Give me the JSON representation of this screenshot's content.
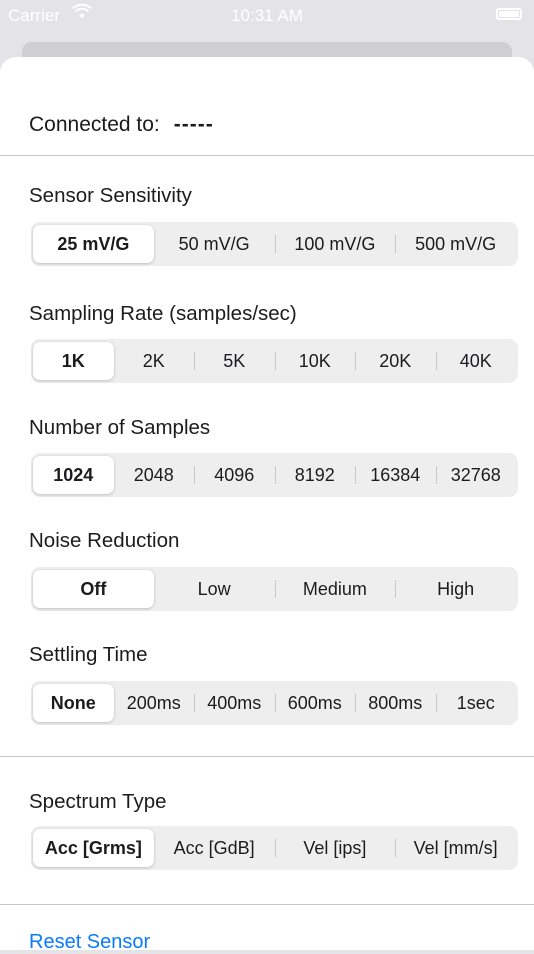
{
  "status_bar": {
    "carrier": "Carrier",
    "time": "10:31 AM"
  },
  "connection": {
    "label": "Connected to:",
    "value": "-----"
  },
  "settings": [
    {
      "label": "Sensor Sensitivity",
      "options": [
        "25 mV/G",
        "50 mV/G",
        "100 mV/G",
        "500 mV/G"
      ],
      "selected": 0
    },
    {
      "label": "Sampling Rate (samples/sec)",
      "options": [
        "1K",
        "2K",
        "5K",
        "10K",
        "20K",
        "40K"
      ],
      "selected": 0
    },
    {
      "label": "Number of Samples",
      "options": [
        "1024",
        "2048",
        "4096",
        "8192",
        "16384",
        "32768"
      ],
      "selected": 0
    },
    {
      "label": "Noise Reduction",
      "options": [
        "Off",
        "Low",
        "Medium",
        "High"
      ],
      "selected": 0
    },
    {
      "label": "Settling Time",
      "options": [
        "None",
        "200ms",
        "400ms",
        "600ms",
        "800ms",
        "1sec"
      ],
      "selected": 0
    },
    {
      "label": "Spectrum Type",
      "options": [
        "Acc [Grms]",
        "Acc [GdB]",
        "Vel [ips]",
        "Vel [mm/s]"
      ],
      "selected": 0
    }
  ],
  "actions": {
    "reset_label": "Reset Sensor"
  },
  "colors": {
    "link": "#0a7aff",
    "segment_bg": "#eeeeef",
    "divider": "#c6c6c8"
  }
}
